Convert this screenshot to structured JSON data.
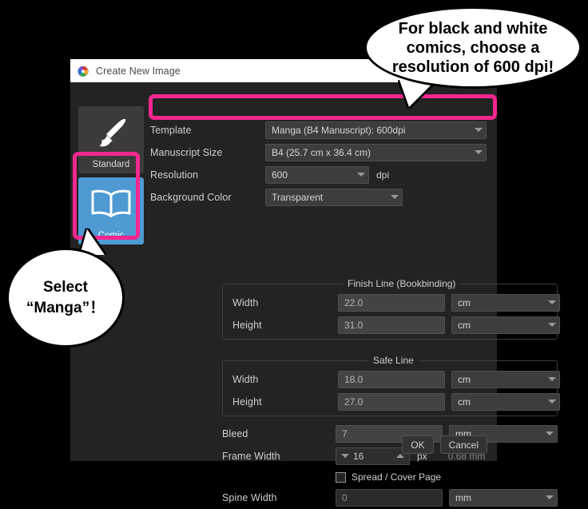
{
  "window": {
    "title": "Create New Image",
    "icon": "color-palette-icon"
  },
  "sidebar": {
    "items": [
      {
        "label": "Standard",
        "icon": "paintbrush-icon",
        "selected": false
      },
      {
        "label": "Comic",
        "icon": "open-book-icon",
        "selected": true
      }
    ]
  },
  "form": {
    "template": {
      "label": "Template",
      "value": "Manga (B4 Manuscript): 600dpi"
    },
    "manuscript_size": {
      "label": "Manuscript Size",
      "value": "B4 (25.7 cm x 36.4 cm)"
    },
    "resolution": {
      "label": "Resolution",
      "value": "600",
      "unit": "dpi"
    },
    "background_color": {
      "label": "Background Color",
      "value": "Transparent"
    }
  },
  "finish_line": {
    "title": "Finish Line (Bookbinding)",
    "width": {
      "label": "Width",
      "value": "22.0",
      "unit": "cm"
    },
    "height": {
      "label": "Height",
      "value": "31.0",
      "unit": "cm"
    }
  },
  "safe_line": {
    "title": "Safe Line",
    "width": {
      "label": "Width",
      "value": "18.0",
      "unit": "cm"
    },
    "height": {
      "label": "Height",
      "value": "27.0",
      "unit": "cm"
    }
  },
  "bottom": {
    "bleed": {
      "label": "Bleed",
      "value": "7",
      "unit": "mm"
    },
    "frame_width": {
      "label": "Frame Width",
      "value": "16",
      "unit": "px",
      "converted": "0.68 mm"
    },
    "spread_cover_page": {
      "label": "Spread / Cover Page",
      "checked": false
    },
    "spine_width": {
      "label": "Spine Width",
      "value": "0",
      "unit": "mm"
    }
  },
  "buttons": {
    "ok": "OK",
    "cancel": "Cancel"
  },
  "annotations": {
    "dpi_bubble": "For black and white comics, choose a resolution of 600 dpi!",
    "manga_bubble": "Select “Manga”！"
  },
  "colors": {
    "highlight_pink": "#f5278f",
    "selected_blue": "#4f9ad3",
    "dialog_bg": "#232323",
    "titlebar_bg": "#ffffff",
    "page_bg": "#000000"
  }
}
